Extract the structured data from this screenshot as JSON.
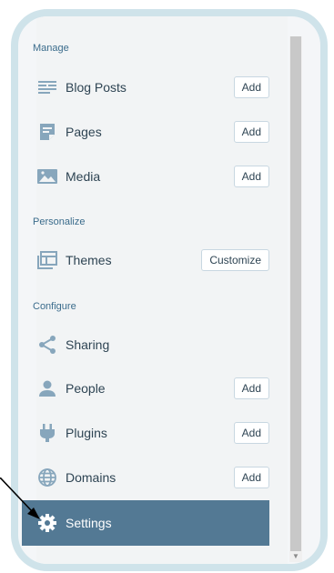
{
  "sections": {
    "manage": "Manage",
    "personalize": "Personalize",
    "configure": "Configure"
  },
  "items": {
    "blog_posts": {
      "label": "Blog Posts",
      "button": "Add",
      "icon": "posts-icon"
    },
    "pages": {
      "label": "Pages",
      "button": "Add",
      "icon": "page-icon"
    },
    "media": {
      "label": "Media",
      "button": "Add",
      "icon": "image-icon"
    },
    "themes": {
      "label": "Themes",
      "button": "Customize",
      "icon": "themes-icon"
    },
    "sharing": {
      "label": "Sharing",
      "icon": "share-icon"
    },
    "people": {
      "label": "People",
      "button": "Add",
      "icon": "person-icon"
    },
    "plugins": {
      "label": "Plugins",
      "button": "Add",
      "icon": "plug-icon"
    },
    "domains": {
      "label": "Domains",
      "button": "Add",
      "icon": "globe-icon"
    },
    "settings": {
      "label": "Settings",
      "icon": "gear-icon",
      "active": true
    }
  },
  "colors": {
    "frame": "#cfe3ea",
    "text": "#2e4453",
    "section": "#3b6c8c",
    "icon": "#87a6bc",
    "active_bg": "#537994"
  }
}
